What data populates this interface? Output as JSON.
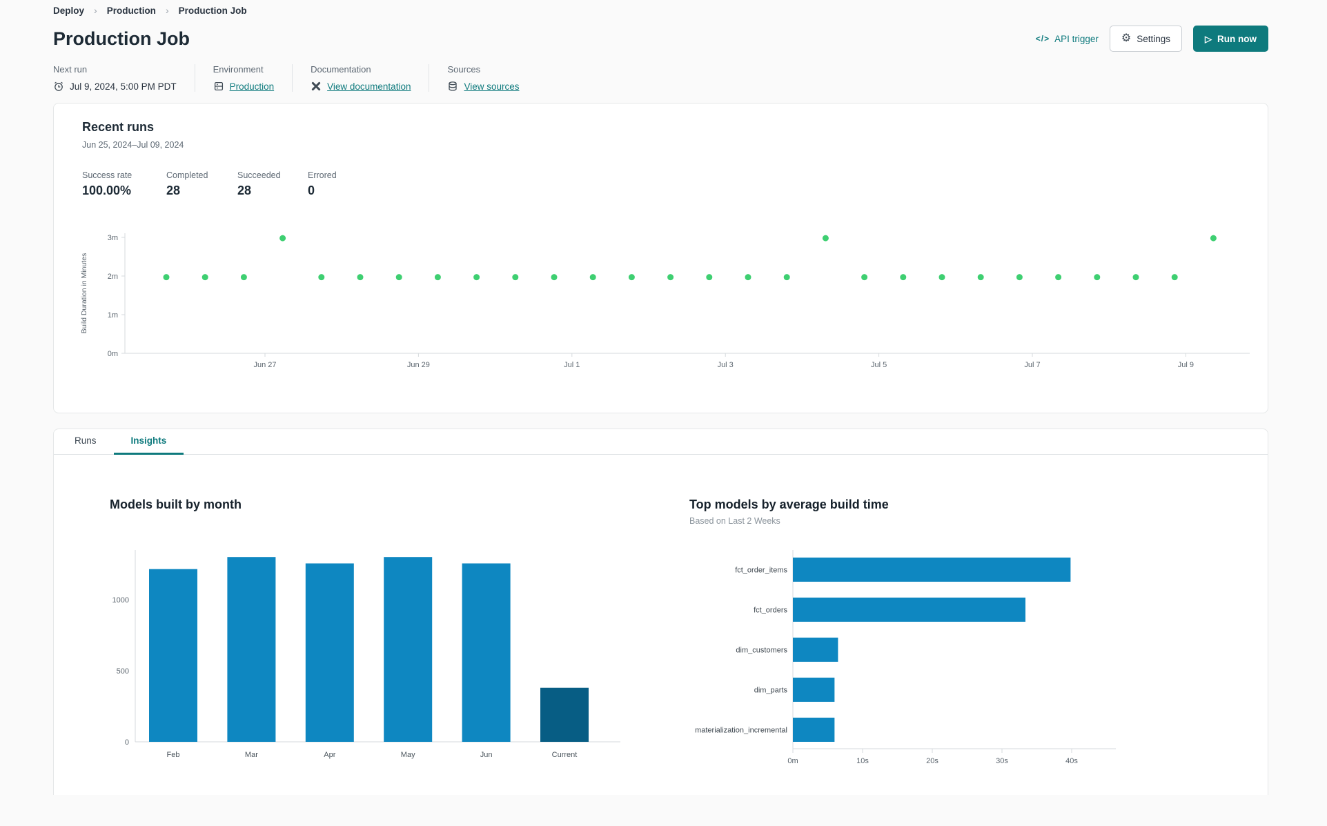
{
  "breadcrumb": {
    "separator": "›",
    "items": [
      {
        "label": "Deploy"
      },
      {
        "label": "Production"
      },
      {
        "label": "Production Job"
      }
    ]
  },
  "header": {
    "title": "Production Job",
    "api_trigger_label": "API trigger",
    "api_trigger_glyph": "</>",
    "settings_label": "Settings",
    "settings_glyph": "⚙",
    "run_now_label": "Run now",
    "run_now_glyph": "▷"
  },
  "meta": {
    "columns": [
      {
        "label": "Next run",
        "value": "Jul 9, 2024, 5:00 PM PDT",
        "icon": "alarm-clock",
        "is_link": false
      },
      {
        "label": "Environment",
        "value": "Production",
        "icon": "environment",
        "is_link": true
      },
      {
        "label": "Documentation",
        "value": "View documentation",
        "icon": "dbt-docs",
        "is_link": true
      },
      {
        "label": "Sources",
        "value": "View sources",
        "icon": "database",
        "is_link": true
      }
    ]
  },
  "recent_runs": {
    "title": "Recent runs",
    "date_range": "Jun 25, 2024–Jul 09, 2024",
    "stats": [
      {
        "label": "Success rate",
        "value": "100.00%"
      },
      {
        "label": "Completed",
        "value": "28"
      },
      {
        "label": "Succeeded",
        "value": "28"
      },
      {
        "label": "Errored",
        "value": "0"
      }
    ]
  },
  "tabs": [
    {
      "label": "Runs",
      "active": false
    },
    {
      "label": "Insights",
      "active": true
    }
  ],
  "colors": {
    "teal_accent": "#0e7a7d",
    "scatter_green": "#3ecf71",
    "bar_blue": "#0e87c1",
    "bar_dark_navy": "#075d84",
    "axis_gray": "#d6dadd",
    "tick_text": "#5b656e"
  },
  "chart_data": [
    {
      "name": "run_build_durations",
      "type": "scatter",
      "ylabel": "Build Duration in Minutes",
      "y_ticks": [
        "0m",
        "1m",
        "2m",
        "3m"
      ],
      "ylim": [
        0,
        3.2
      ],
      "x_ticks": [
        "Jun 27",
        "Jun 29",
        "Jul 1",
        "Jul 3",
        "Jul 5",
        "Jul 7",
        "Jul 9"
      ],
      "point_color": "#3ecf71",
      "points_minutes": [
        1.97,
        1.97,
        1.97,
        2.98,
        1.97,
        1.97,
        1.97,
        1.97,
        1.97,
        1.97,
        1.97,
        1.97,
        1.97,
        1.97,
        1.97,
        1.97,
        1.97,
        2.98,
        1.97,
        1.97,
        1.97,
        1.97,
        1.97,
        1.97,
        1.97,
        1.97,
        1.97,
        2.98
      ]
    },
    {
      "name": "models_built_by_month",
      "type": "bar",
      "title": "Models built by month",
      "categories": [
        "Feb",
        "Mar",
        "Apr",
        "May",
        "Jun",
        "Current"
      ],
      "values": [
        1215,
        1300,
        1255,
        1300,
        1255,
        380
      ],
      "colors": [
        "#0e87c1",
        "#0e87c1",
        "#0e87c1",
        "#0e87c1",
        "#0e87c1",
        "#075d84"
      ],
      "y_ticks": [
        0,
        500,
        1000
      ],
      "ylim": [
        0,
        1400
      ],
      "xlabel": "",
      "ylabel": ""
    },
    {
      "name": "top_models_by_average_build_time",
      "type": "horizontal_bar",
      "title": "Top models by average build time",
      "subtitle": "Based on Last 2 Weeks",
      "categories": [
        "fct_order_items",
        "fct_orders",
        "dim_customers",
        "dim_parts",
        "materialization_incremental"
      ],
      "values_seconds": [
        40,
        33.5,
        6.5,
        6,
        6
      ],
      "x_ticks": [
        "0m",
        "10s",
        "20s",
        "30s",
        "40s"
      ],
      "xlim": [
        0,
        46
      ],
      "bar_color": "#0e87c1"
    }
  ]
}
